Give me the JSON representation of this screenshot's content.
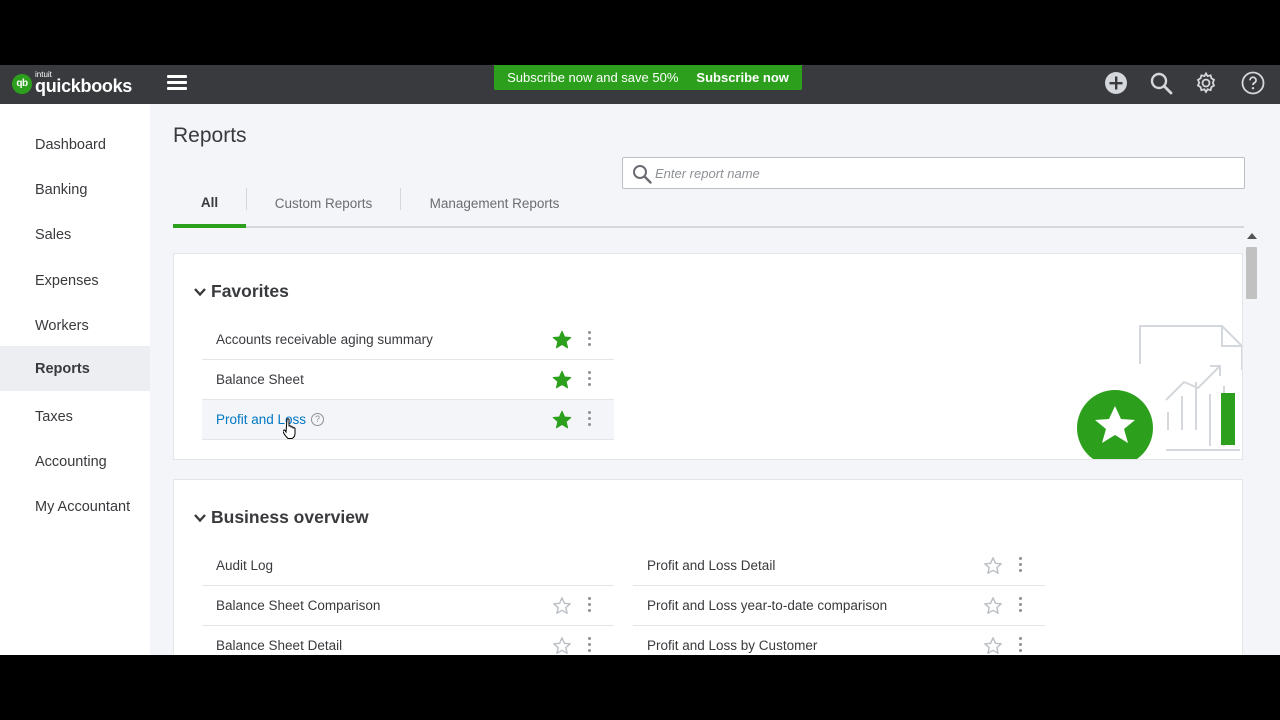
{
  "brand": {
    "badge": "qb",
    "small": "intuit",
    "name": "quickbooks"
  },
  "promo": {
    "text": "Subscribe now and save 50%",
    "link": "Subscribe now"
  },
  "sidebar": {
    "items": [
      {
        "label": "Dashboard"
      },
      {
        "label": "Banking"
      },
      {
        "label": "Sales"
      },
      {
        "label": "Expenses"
      },
      {
        "label": "Workers"
      },
      {
        "label": "Reports"
      },
      {
        "label": "Taxes"
      },
      {
        "label": "Accounting"
      },
      {
        "label": "My Accountant"
      }
    ],
    "active": "Reports"
  },
  "page": {
    "title": "Reports"
  },
  "tabs": [
    {
      "label": "All"
    },
    {
      "label": "Custom Reports"
    },
    {
      "label": "Management Reports"
    }
  ],
  "active_tab": "All",
  "search": {
    "placeholder": "Enter report name",
    "value": ""
  },
  "favorites": {
    "title": "Favorites",
    "items": [
      {
        "label": "Accounts receivable aging summary",
        "favorite": true
      },
      {
        "label": "Balance Sheet",
        "favorite": true
      },
      {
        "label": "Profit and Loss",
        "favorite": true,
        "help": "?"
      }
    ]
  },
  "business_overview": {
    "title": "Business overview",
    "left": [
      {
        "label": "Audit Log",
        "favorite": false
      },
      {
        "label": "Balance Sheet Comparison",
        "favorite": false
      },
      {
        "label": "Balance Sheet Detail",
        "favorite": false
      }
    ],
    "right": [
      {
        "label": "Profit and Loss Detail",
        "favorite": false
      },
      {
        "label": "Profit and Loss year-to-date comparison",
        "favorite": false
      },
      {
        "label": "Profit and Loss by Customer",
        "favorite": false
      }
    ]
  },
  "colors": {
    "brand_green": "#2ca01c",
    "topbar": "#393a3d",
    "link_blue": "#0077c5"
  }
}
